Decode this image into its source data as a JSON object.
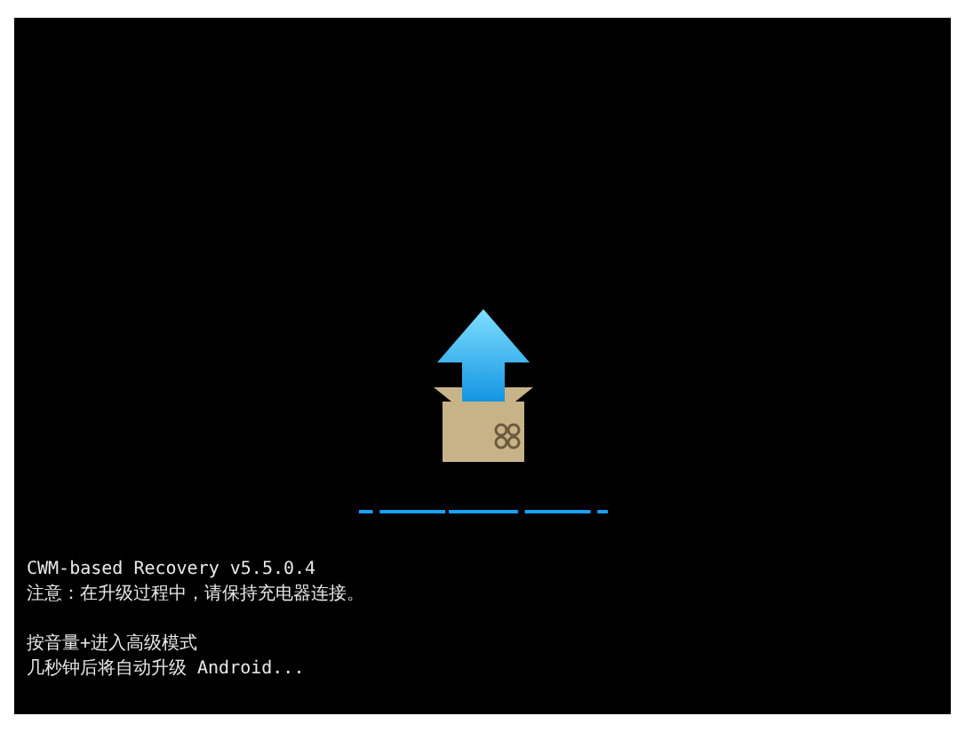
{
  "log_groups": [
    [
      "CWM-based Recovery v5.5.0.4",
      "注意：在升级过程中，请保持充电器连接。"
    ],
    [
      "按音量+进入高级模式",
      "几秒钟后将自动升级 Android..."
    ]
  ]
}
